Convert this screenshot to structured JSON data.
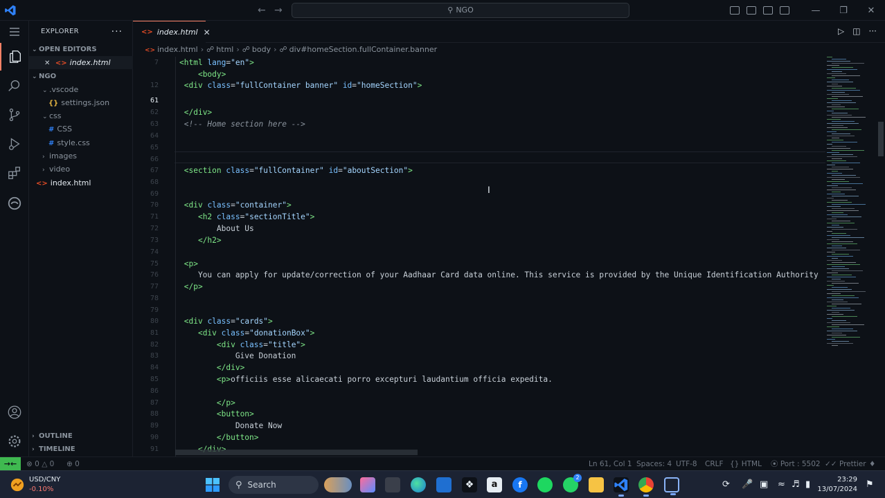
{
  "window": {
    "search_text": "NGO"
  },
  "sidebar": {
    "title": "EXPLORER",
    "open_editors_label": "OPEN EDITORS",
    "open_editor_file": "index.html",
    "project_label": "NGO",
    "tree": [
      {
        "label": ".vscode",
        "type": "folder",
        "icon": "chevron-down"
      },
      {
        "label": "settings.json",
        "type": "file",
        "icon": "json"
      },
      {
        "label": "css",
        "type": "folder",
        "icon": "chevron-down"
      },
      {
        "label": "CSS",
        "type": "file",
        "icon": "css"
      },
      {
        "label": "style.css",
        "type": "file",
        "icon": "css"
      },
      {
        "label": "images",
        "type": "folder",
        "icon": "chevron-right"
      },
      {
        "label": "video",
        "type": "folder",
        "icon": "chevron-right"
      },
      {
        "label": "index.html",
        "type": "file",
        "icon": "html"
      }
    ],
    "outline_label": "OUTLINE",
    "timeline_label": "TIMELINE"
  },
  "editor": {
    "tab_label": "index.html",
    "breadcrumb": [
      "index.html",
      "html",
      "body",
      "div#homeSection.fullContainer.banner"
    ],
    "lines": [
      {
        "n": "7",
        "tokens": [
          [
            "tag",
            "<html "
          ],
          [
            "attr",
            "lang"
          ],
          [
            "txt",
            "="
          ],
          [
            "str",
            "\"en\""
          ],
          [
            "tag",
            ">"
          ]
        ]
      },
      {
        "n": "",
        "tokens": [
          [
            "txt",
            "    "
          ],
          [
            "tag",
            "<body>"
          ]
        ]
      },
      {
        "n": "12",
        "tokens": [
          [
            "txt",
            " "
          ],
          [
            "tag",
            "<div "
          ],
          [
            "attr",
            "class"
          ],
          [
            "txt",
            "="
          ],
          [
            "str",
            "\"fullContainer banner\""
          ],
          [
            "txt",
            " "
          ],
          [
            "attr",
            "id"
          ],
          [
            "txt",
            "="
          ],
          [
            "str",
            "\"homeSection\""
          ],
          [
            "tag",
            ">"
          ]
        ]
      },
      {
        "n": "",
        "tokens": []
      },
      {
        "n": "61",
        "tokens": [],
        "current": true
      },
      {
        "n": "",
        "tokens": []
      },
      {
        "n": "62",
        "tokens": [
          [
            "txt",
            " "
          ],
          [
            "tag",
            "</div>"
          ]
        ]
      },
      {
        "n": "63",
        "tokens": [
          [
            "txt",
            " "
          ],
          [
            "cmt",
            "<!-- Home section here -->"
          ]
        ]
      },
      {
        "n": "64",
        "tokens": []
      },
      {
        "n": "65",
        "tokens": []
      },
      {
        "n": "66",
        "tokens": []
      },
      {
        "n": "67",
        "tokens": [
          [
            "txt",
            " "
          ],
          [
            "tag",
            "<section "
          ],
          [
            "attr",
            "class"
          ],
          [
            "txt",
            "="
          ],
          [
            "str",
            "\"fullContainer\""
          ],
          [
            "txt",
            " "
          ],
          [
            "attr",
            "id"
          ],
          [
            "txt",
            "="
          ],
          [
            "str",
            "\"aboutSection\""
          ],
          [
            "tag",
            ">"
          ]
        ]
      },
      {
        "n": "68",
        "tokens": []
      },
      {
        "n": "69",
        "tokens": []
      },
      {
        "n": "70",
        "tokens": [
          [
            "txt",
            " "
          ],
          [
            "tag",
            "<div "
          ],
          [
            "attr",
            "class"
          ],
          [
            "txt",
            "="
          ],
          [
            "str",
            "\"container\""
          ],
          [
            "tag",
            ">"
          ]
        ]
      },
      {
        "n": "71",
        "tokens": [
          [
            "txt",
            "    "
          ],
          [
            "tag",
            "<h2 "
          ],
          [
            "attr",
            "class"
          ],
          [
            "txt",
            "="
          ],
          [
            "str",
            "\"sectionTitle\""
          ],
          [
            "tag",
            ">"
          ]
        ]
      },
      {
        "n": "72",
        "tokens": [
          [
            "txt",
            "        About Us"
          ]
        ]
      },
      {
        "n": "73",
        "tokens": [
          [
            "txt",
            "    "
          ],
          [
            "tag",
            "</h2>"
          ]
        ]
      },
      {
        "n": "74",
        "tokens": []
      },
      {
        "n": "75",
        "tokens": [
          [
            "txt",
            " "
          ],
          [
            "tag",
            "<p>"
          ]
        ]
      },
      {
        "n": "76",
        "tokens": [
          [
            "txt",
            "    You can apply for update/correction of your Aadhaar Card data online. This service is provided by the Unique Identification Authority"
          ]
        ]
      },
      {
        "n": "77",
        "tokens": [
          [
            "txt",
            " "
          ],
          [
            "tag",
            "</p>"
          ]
        ]
      },
      {
        "n": "78",
        "tokens": []
      },
      {
        "n": "79",
        "tokens": []
      },
      {
        "n": "80",
        "tokens": [
          [
            "txt",
            " "
          ],
          [
            "tag",
            "<div "
          ],
          [
            "attr",
            "class"
          ],
          [
            "txt",
            "="
          ],
          [
            "str",
            "\"cards\""
          ],
          [
            "tag",
            ">"
          ]
        ]
      },
      {
        "n": "81",
        "tokens": [
          [
            "txt",
            "    "
          ],
          [
            "tag",
            "<div "
          ],
          [
            "attr",
            "class"
          ],
          [
            "txt",
            "="
          ],
          [
            "str",
            "\"donationBox\""
          ],
          [
            "tag",
            ">"
          ]
        ]
      },
      {
        "n": "82",
        "tokens": [
          [
            "txt",
            "        "
          ],
          [
            "tag",
            "<div "
          ],
          [
            "attr",
            "class"
          ],
          [
            "txt",
            "="
          ],
          [
            "str",
            "\"title\""
          ],
          [
            "tag",
            ">"
          ]
        ]
      },
      {
        "n": "83",
        "tokens": [
          [
            "txt",
            "            Give Donation"
          ]
        ]
      },
      {
        "n": "84",
        "tokens": [
          [
            "txt",
            "        "
          ],
          [
            "tag",
            "</div>"
          ]
        ]
      },
      {
        "n": "85",
        "tokens": [
          [
            "txt",
            "        "
          ],
          [
            "tag",
            "<p>"
          ],
          [
            "txt",
            "officiis esse alicaecati porro excepturi laudantium officia expedita."
          ]
        ]
      },
      {
        "n": "86",
        "tokens": []
      },
      {
        "n": "87",
        "tokens": [
          [
            "txt",
            "        "
          ],
          [
            "tag",
            "</p>"
          ]
        ]
      },
      {
        "n": "88",
        "tokens": [
          [
            "txt",
            "        "
          ],
          [
            "tag",
            "<button>"
          ]
        ]
      },
      {
        "n": "89",
        "tokens": [
          [
            "txt",
            "            Donate Now"
          ]
        ]
      },
      {
        "n": "90",
        "tokens": [
          [
            "txt",
            "        "
          ],
          [
            "tag",
            "</button>"
          ]
        ]
      },
      {
        "n": "91",
        "tokens": [
          [
            "txt",
            "    "
          ],
          [
            "tag",
            "</div>"
          ]
        ]
      }
    ]
  },
  "statusbar": {
    "errors": "0",
    "warnings": "0",
    "ports": "0",
    "position": "Ln 61, Col 1",
    "spaces": "Spaces: 4",
    "encoding": "UTF-8",
    "eol": "CRLF",
    "language": "HTML",
    "port": "Port : 5502",
    "formatter": "Prettier"
  },
  "taskbar": {
    "widget_title": "USD/CNY",
    "widget_change": "-0.10%",
    "search_label": "Search",
    "time": "23:29",
    "date": "13/07/2024",
    "whatsapp_badge": "2"
  },
  "colors": {
    "accent": "#f78166",
    "remote": "#3fb950",
    "tag": "#7ee787",
    "attr": "#79c0ff",
    "string": "#a5d6ff"
  }
}
